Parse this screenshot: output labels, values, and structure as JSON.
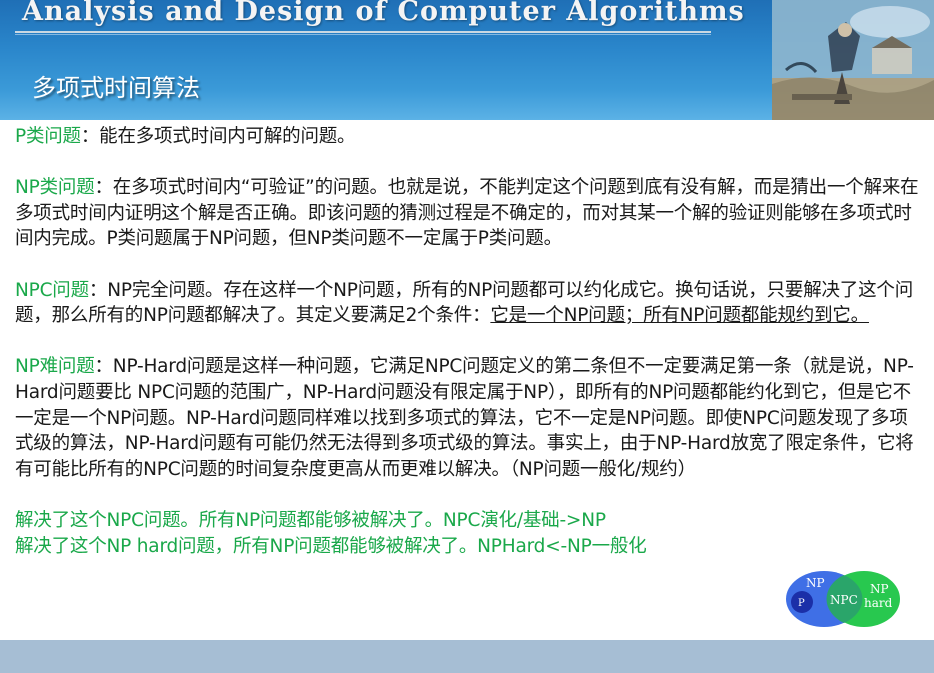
{
  "header": {
    "title": "Analysis and Design of Computer Algorithms",
    "section": "多项式时间算法"
  },
  "p": {
    "term": "P类问题",
    "text": "：能在多项式时间内可解的问题。"
  },
  "np": {
    "term": "NP类问题",
    "text": "：在多项式时间内“可验证”的问题。也就是说，不能判定这个问题到底有没有解，而是猜出一个解来在多项式时间内证明这个解是否正确。即该问题的猜测过程是不确定的，而对其某一个解的验证则能够在多项式时间内完成。P类问题属于NP问题，但NP类问题不一定属于P类问题。"
  },
  "npc": {
    "term": "NPC问题",
    "text": "：NP完全问题。存在这样一个NP问题，所有的NP问题都可以约化成它。换句话说，只要解决了这个问题，那么所有的NP问题都解决了。其定义要满足2个条件：",
    "underlined": "它是一个NP问题；所有NP问题都能规约到它。"
  },
  "nphard": {
    "term": "NP难问题",
    "text": "：NP-Hard问题是这样一种问题，它满足NPC问题定义的第二条但不一定要满足第一条（就是说，NP-Hard问题要比 NPC问题的范围广，NP-Hard问题没有限定属于NP），即所有的NP问题都能约化到它，但是它不一定是一个NP问题。NP-Hard问题同样难以找到多项式的算法，它不一定是NP问题。即使NPC问题发现了多项式级的算法，NP-Hard问题有可能仍然无法得到多项式级的算法。事实上，由于NP-Hard放宽了限定条件，它将有可能比所有的NPC问题的时间复杂度更高从而更难以解决。（NP问题一般化/规约）"
  },
  "summary": {
    "line1": "解决了这个NPC问题。所有NP问题都能够被解决了。NPC演化/基础->NP",
    "line2": "解决了这个NP hard问题，所有NP问题都能够被解决了。NPHard<-NP一般化"
  },
  "venn": {
    "np": "NP",
    "p": "P",
    "npc": "NPC",
    "np_hard_1": "NP",
    "np_hard_2": "hard"
  },
  "colors": {
    "term": "#1aa84a",
    "header_blue": "#2a86cb",
    "footer": "#a6bed4",
    "venn_np": "#3f6fe6",
    "venn_hard": "#28c84f",
    "venn_overlap": "#2aa56a"
  }
}
